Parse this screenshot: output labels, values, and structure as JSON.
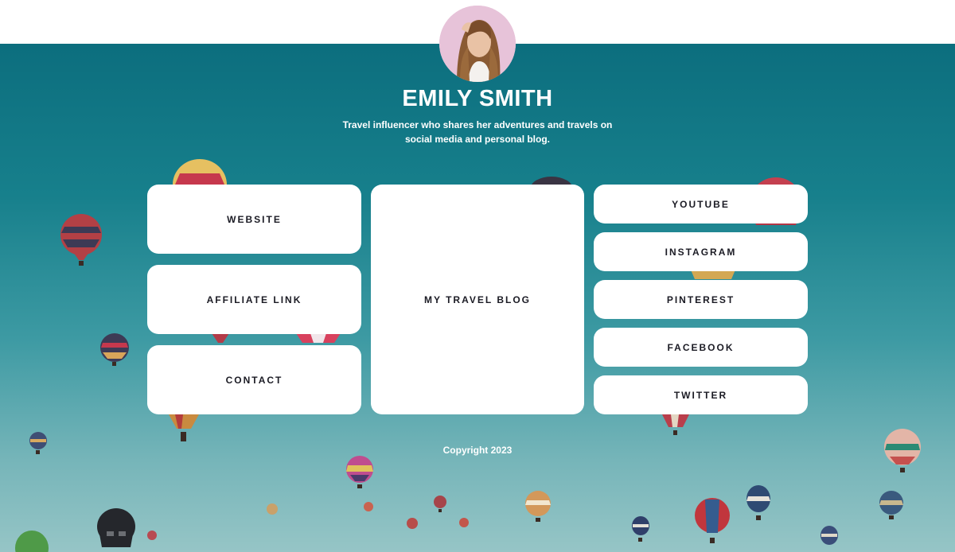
{
  "profile": {
    "name": "EMILY SMITH",
    "tagline_line1": "Travel influencer who shares her adventures and travels on",
    "tagline_line2": "social media and personal blog."
  },
  "links": {
    "website": "WEBSITE",
    "affiliate": "AFFILIATE LINK",
    "contact": "CONTACT",
    "blog": "MY TRAVEL BLOG",
    "youtube": "YOUTUBE",
    "instagram": "INSTAGRAM",
    "pinterest": "PINTEREST",
    "facebook": "FACEBOOK",
    "twitter": "TWITTER"
  },
  "footer": {
    "copyright": "Copyright 2023"
  },
  "colors": {
    "sky_top": "#0c6e7e",
    "sky_bottom": "#96c5c6",
    "card_bg": "#ffffff",
    "card_text": "#1b1b24",
    "avatar_bg": "#e7c3d9"
  }
}
